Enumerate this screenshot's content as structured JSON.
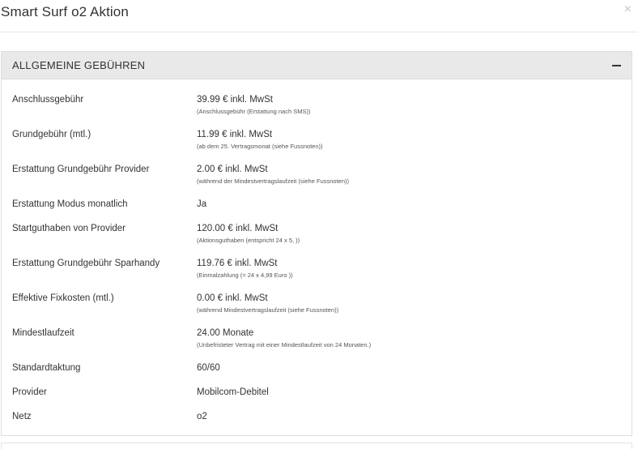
{
  "modal": {
    "title": "Smart Surf o2 Aktion",
    "close_label": "×"
  },
  "section": {
    "title": "ALLGEMEINE GEBÜHREN"
  },
  "rows": [
    {
      "label": "Anschlussgebühr",
      "value": "39.99 € inkl. MwSt",
      "note": "(Anschlussgebühr (Erstattung nach SMS))",
      "highlighted": false
    },
    {
      "label": "Grundgebühr (mtl.)",
      "value": "11.99 € inkl. MwSt",
      "note": "(ab dem 25. Vertragsmonat (siehe Fussnoten))",
      "highlighted": false
    },
    {
      "label": "Erstattung Grundgebühr Provider",
      "value": "2.00 € inkl. MwSt",
      "note": "(während der Mindestvertragslaufzeit (siehe Fussnoten))",
      "highlighted": false
    },
    {
      "label": "Erstattung Modus monatlich",
      "value": "Ja",
      "note": "",
      "highlighted": false
    },
    {
      "label": "Startguthaben von Provider",
      "value": "120.00 € inkl. MwSt",
      "note": "(Aktionsguthaben (entspricht 24 x 5, ))",
      "highlighted": true
    },
    {
      "label": "Erstattung Grundgebühr Sparhandy",
      "value": "119.76 € inkl. MwSt",
      "note": "(Einmalzahlung (= 24 x 4,99 Euro ))",
      "highlighted": true
    },
    {
      "label": "Effektive Fixkosten (mtl.)",
      "value": "0.00 € inkl. MwSt",
      "note": "(während Mindestvertragslaufzeit (siehe Fussnoten))",
      "highlighted": true
    },
    {
      "label": "Mindestlaufzeit",
      "value": "24.00 Monate",
      "note": "(Unbefristeter Vertrag mit einer Mindestlaufzeit von 24 Monaten.)",
      "highlighted": false
    },
    {
      "label": "Standardtaktung",
      "value": "60/60",
      "note": "",
      "highlighted": false
    },
    {
      "label": "Provider",
      "value": "Mobilcom-Debitel",
      "note": "",
      "highlighted": false
    },
    {
      "label": "Netz",
      "value": "o2",
      "note": "",
      "highlighted": false
    }
  ],
  "colors": {
    "highlight": "#f8fb34",
    "panel_heading_bg": "#e9e9e9"
  }
}
